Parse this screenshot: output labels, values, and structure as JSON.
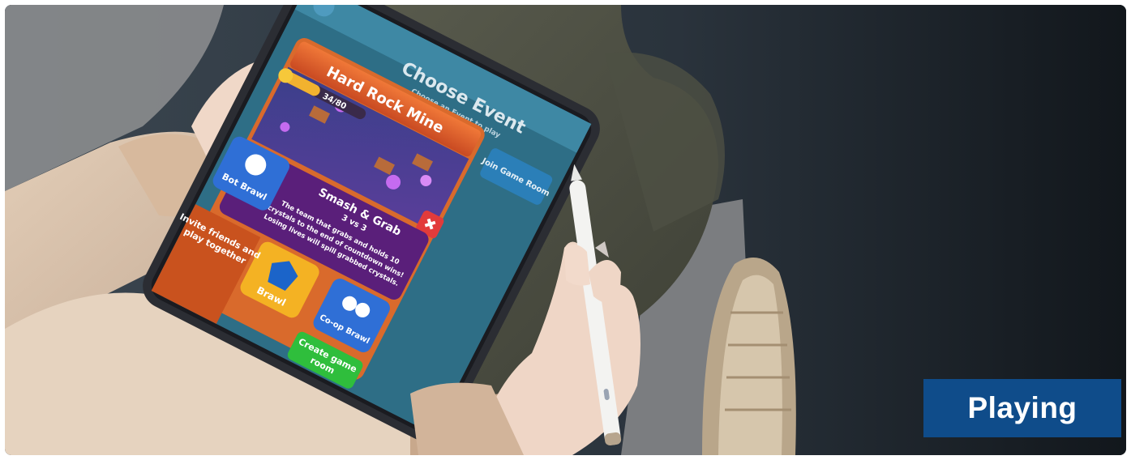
{
  "game_screen": {
    "header_title": "Choose Event",
    "header_subtitle": "Choose an Event to play",
    "join_button": "Join Game Room",
    "event_name": "Hard Rock Mine",
    "progress": "34/80",
    "progress_fraction": 0.425,
    "mode_title": "Smash & Grab",
    "mode_teams": "3 vs 3",
    "mode_desc_1": "The team that grabs and holds 10",
    "mode_desc_2": "crystals to the end of countdown wins!",
    "mode_desc_3": "Losing lives will spill grabbed crystals.",
    "bot_brawl": "Bot Brawl",
    "brawl": "Brawl",
    "coop_brawl": "Co-op Brawl",
    "invite_1": "Invite friends and",
    "invite_2": "play together",
    "create_1": "Create game",
    "create_2": "room"
  },
  "caption": {
    "label": "Playing",
    "color": "#0f4c8a"
  }
}
